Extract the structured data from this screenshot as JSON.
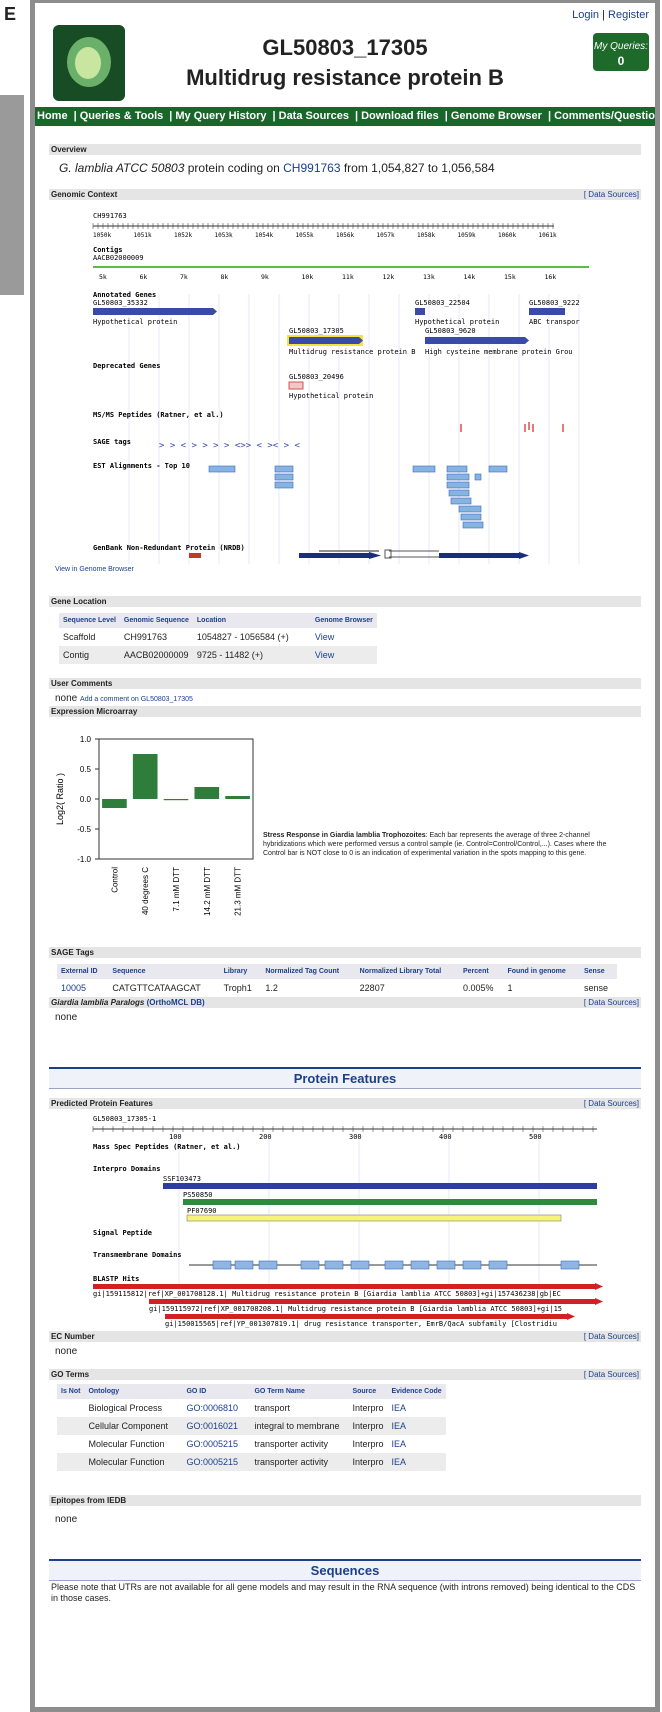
{
  "figure_letter": "E",
  "header": {
    "gene_id": "GL50803_17305",
    "product": "Multidrug resistance protein B",
    "login": "Login",
    "register": "Register",
    "my_queries_label": "My Queries:",
    "my_queries_count": "0"
  },
  "nav": [
    "Home",
    "Queries & Tools",
    "My Query History",
    "Data Sources",
    "Download files",
    "Genome Browser",
    "Comments/Questions?"
  ],
  "overview": {
    "title": "Overview",
    "organism": "G. lamblia ATCC 50803",
    "text1": " protein coding on ",
    "contig_link": "CH991763",
    "text2": " from 1,054,827 to 1,056,584"
  },
  "genomic_context": {
    "title": "Genomic Context",
    "data_sources": "[ Data Sources]",
    "chrom": "CH991763",
    "scale_top": [
      "1050k",
      "1051k",
      "1052k",
      "1053k",
      "1054k",
      "1055k",
      "1056k",
      "1057k",
      "1058k",
      "1059k",
      "1060k",
      "1061k"
    ],
    "contigs_label": "Contigs",
    "contig_name": "AACB02000009",
    "scale_contig": [
      "5k",
      "6k",
      "7k",
      "8k",
      "9k",
      "10k",
      "11k",
      "12k",
      "13k",
      "14k",
      "15k",
      "16k"
    ],
    "annotated_label": "Annotated Genes",
    "genes": [
      {
        "id": "GL50803_35332",
        "desc": "Hypothetical protein"
      },
      {
        "id": "GL50803_22504",
        "desc": "Hypothetical protein"
      },
      {
        "id": "GL50803_9222",
        "desc": "ABC transpor"
      },
      {
        "id": "GL50803_17305",
        "desc": "Multidrug resistance protein B"
      },
      {
        "id": "GL50803_9620",
        "desc": "High cysteine membrane protein Grou"
      }
    ],
    "deprecated_label": "Deprecated Genes",
    "deprecated_gene": "GL50803_20496",
    "deprecated_desc": "Hypothetical protein",
    "msms_label": "MS/MS Peptides (Ratner, et al.)",
    "sage_label": "SAGE tags",
    "est_label": "EST Alignments - Top 10",
    "genbank_label": "GenBank Non-Redundant Protein (NRDB)",
    "view_in_browser": "View in Genome Browser"
  },
  "gene_location": {
    "title": "Gene Location",
    "headers": [
      "Sequence Level",
      "Genomic Sequence",
      "Location",
      "Genome Browser"
    ],
    "rows": [
      [
        "Scaffold",
        "CH991763",
        "1054827 - 1056584 (+)",
        "View"
      ],
      [
        "Contig",
        "AACB02000009",
        "9725 - 11482 (+)",
        "View"
      ]
    ]
  },
  "user_comments": {
    "title": "User Comments",
    "none": "none",
    "add_link": "Add a comment on GL50803_17305"
  },
  "microarray": {
    "title": "Expression Microarray",
    "description_bold": "Stress Response in Giardia lamblia Trophozoites",
    "description": ": Each bar represents the average of three 2-channel hybridizations which were performed versus a control sample (ie. Control=Control/Control,...). Cases where the Control bar is NOT close to 0 is an indication of experimental variation in the spots mapping to this gene."
  },
  "chart_data": {
    "type": "bar",
    "categories": [
      "Control",
      "40 degrees C",
      "7.1 mM DTT",
      "14.2 mM DTT",
      "21.3 mM DTT"
    ],
    "values": [
      -0.15,
      0.75,
      -0.02,
      0.2,
      0.05
    ],
    "ylabel": "Log2( Ratio )",
    "ylim": [
      -1.0,
      1.0
    ],
    "yticks": [
      "1.0",
      "0.5",
      "0.0",
      "-0.5",
      "-1.0"
    ],
    "bar_color": "#2e7d3a"
  },
  "sage_tags": {
    "title": "SAGE Tags",
    "headers": [
      "External ID",
      "Sequence",
      "Library",
      "Normalized Tag Count",
      "Normalized Library Total",
      "Percent",
      "Found in genome",
      "Sense"
    ],
    "row": [
      "10005",
      "CATGTTCATAAGCAT",
      "Troph1",
      "1.2",
      "22807",
      "0.005%",
      "1",
      "sense"
    ]
  },
  "paralogs": {
    "title": "Giardia lamblia Paralogs",
    "source": "(OrthoMCL DB)",
    "data_sources": "[ Data Sources]",
    "none": "none"
  },
  "protein_features_band": "Protein Features",
  "predicted": {
    "title": "Predicted Protein Features",
    "data_sources": "[ Data Sources]",
    "protein": "GL50803_17305-1",
    "scale": [
      "100",
      "200",
      "300",
      "400",
      "500"
    ],
    "ms_label": "Mass Spec Peptides (Ratner, et al.)",
    "interpro_label": "Interpro Domains",
    "domains": [
      "SSF103473",
      "PS50850",
      "PF07690"
    ],
    "signal_label": "Signal Peptide",
    "tm_label": "Transmembrane Domains",
    "blastp_label": "BLASTP Hits",
    "blast_hits": [
      "gi|159115812|ref|XP_001708128.1| Multidrug resistance protein B [Giardia lamblia ATCC 50803]+gi|157436238|gb|EC",
      "gi|159115972|ref|XP_001708208.1| Multidrug resistance protein B [Giardia lamblia ATCC 50803]+gi|15",
      "gi|150015565|ref|YP_001307819.1| drug resistance transporter, EmrB/QacA subfamily [Clostridiu"
    ]
  },
  "ec_number": {
    "title": "EC Number",
    "data_sources": "[ Data Sources]",
    "none": "none"
  },
  "go_terms": {
    "title": "GO Terms",
    "data_sources": "[ Data Sources]",
    "headers": [
      "Is Not",
      "Ontology",
      "GO ID",
      "GO Term Name",
      "Source",
      "Evidence Code"
    ],
    "rows": [
      [
        "",
        "Biological Process",
        "GO:0006810",
        "transport",
        "Interpro",
        "IEA"
      ],
      [
        "",
        "Cellular Component",
        "GO:0016021",
        "integral to membrane",
        "Interpro",
        "IEA"
      ],
      [
        "",
        "Molecular Function",
        "GO:0005215",
        "transporter activity",
        "Interpro",
        "IEA"
      ],
      [
        "",
        "Molecular Function",
        "GO:0005215",
        "transporter activity",
        "Interpro",
        "IEA"
      ]
    ]
  },
  "epitopes": {
    "title": "Epitopes from IEDB",
    "none": "none"
  },
  "sequences_band": "Sequences",
  "sequences_note": "Please note that UTRs are not available for all gene models and may result in the RNA sequence (with introns removed) being identical to the CDS in those cases."
}
